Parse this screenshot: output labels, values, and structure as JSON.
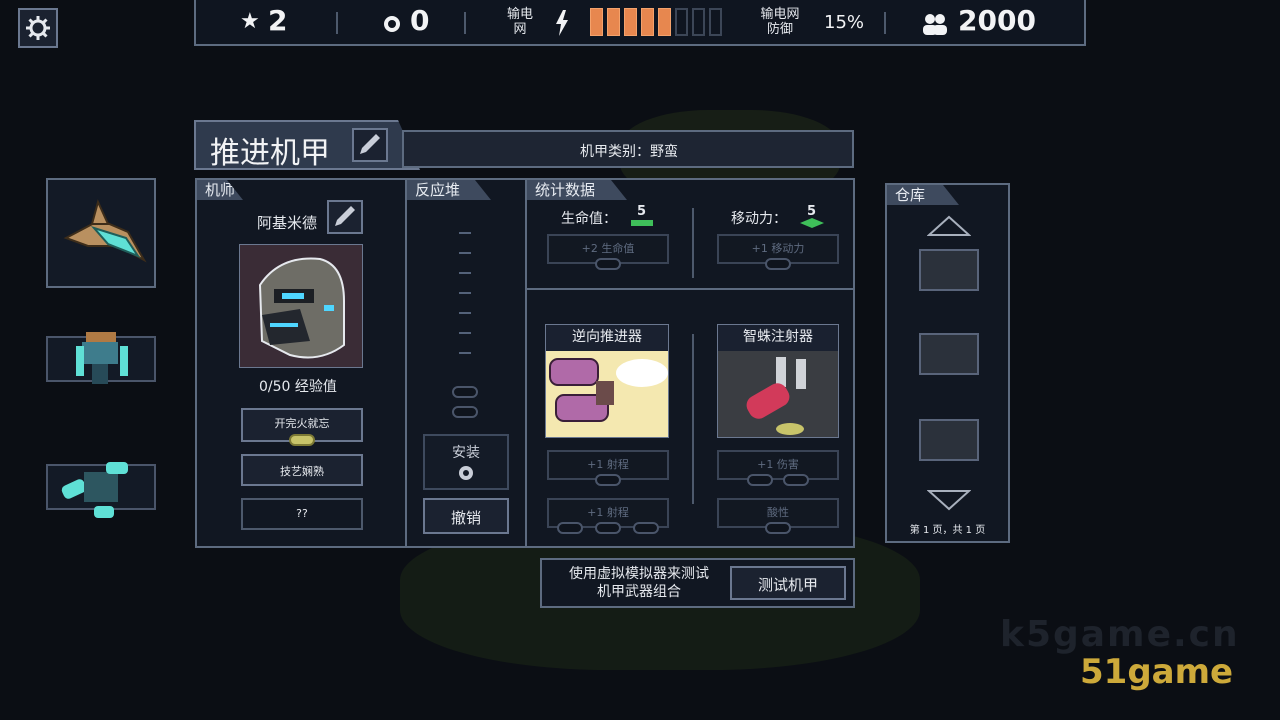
{
  "topbar": {
    "stars": "2",
    "cores": "0",
    "power_grid_label": "输电\n网",
    "power_bars_filled": 5,
    "power_bars_total": 8,
    "grid_defense_label": "输电网\n防御",
    "grid_defense_value": "15%",
    "people": "2000"
  },
  "mech": {
    "name": "推进机甲",
    "class_label": "机甲类别：野蛮"
  },
  "pilot": {
    "header": "机师",
    "name": "阿基米德",
    "xp": "0/50 经验值",
    "skills": [
      "开完火就忘",
      "技艺娴熟",
      "??"
    ]
  },
  "reactor": {
    "header": "反应堆",
    "install_label": "安装",
    "undo_label": "撤销"
  },
  "stats": {
    "header": "统计数据",
    "health_label": "生命值：",
    "health_value": "5",
    "health_upgrade": "+2 生命值",
    "move_label": "移动力：",
    "move_value": "5",
    "move_upgrade": "+1 移动力"
  },
  "weapons": [
    {
      "name": "逆向推进器",
      "upgrades": [
        "+1 射程",
        "+1 射程"
      ]
    },
    {
      "name": "智蛛注射器",
      "upgrades": [
        "+1 伤害",
        "酸性"
      ]
    }
  ],
  "test": {
    "description": "使用虚拟模拟器来测试\n机甲武器组合",
    "button_label": "测试机甲"
  },
  "storage": {
    "header": "仓库",
    "pagination": "第 1 页，共 1 页"
  },
  "watermark": {
    "faint": "k5game.cn",
    "brand": "51game"
  },
  "colors": {
    "power_on": "#e7874f",
    "accent_gold": "#cda93a",
    "panel_border": "#5d6b80"
  }
}
